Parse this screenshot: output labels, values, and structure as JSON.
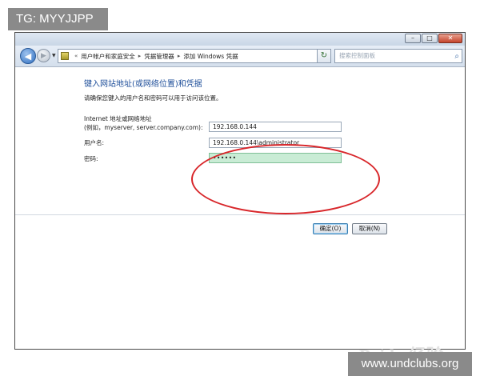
{
  "overlay": {
    "tg_badge": "TG: MYYJJPP",
    "site_badge": "www.undclubs.org"
  },
  "titlebar": {
    "controls": {
      "minimize": "–",
      "maximize": "□",
      "close": "✕"
    }
  },
  "navbar": {
    "breadcrumb": [
      "用户帐户和家庭安全",
      "凭据管理器",
      "添加 Windows 凭据"
    ],
    "search_placeholder": "搜索控制面板"
  },
  "form": {
    "heading": "键入网站地址(或网络位置)和凭据",
    "instruction": "请确保您键入的用户名和密码可以用于访问该位置。",
    "address_label_line1": "Internet 地址或网络地址",
    "address_label_line2": "(例如，myserver, server.company.com):",
    "address_value": "192.168.0.144",
    "username_label": "用户名:",
    "username_value": "192.168.0.144\\administrator",
    "password_label": "密码:",
    "password_value": "••••••"
  },
  "buttons": {
    "ok": "确定(O)",
    "cancel": "取消(N)"
  },
  "watermark": "Baidu 经验",
  "icons": {
    "back": "arrow-left-icon",
    "forward": "arrow-right-icon",
    "refresh": "refresh-icon",
    "search": "search-icon",
    "control_panel": "control-panel-icon"
  },
  "colors": {
    "heading": "#1f4f9a",
    "highlight_ellipse": "#d8262a",
    "password_fill": "#c9ecd5"
  }
}
